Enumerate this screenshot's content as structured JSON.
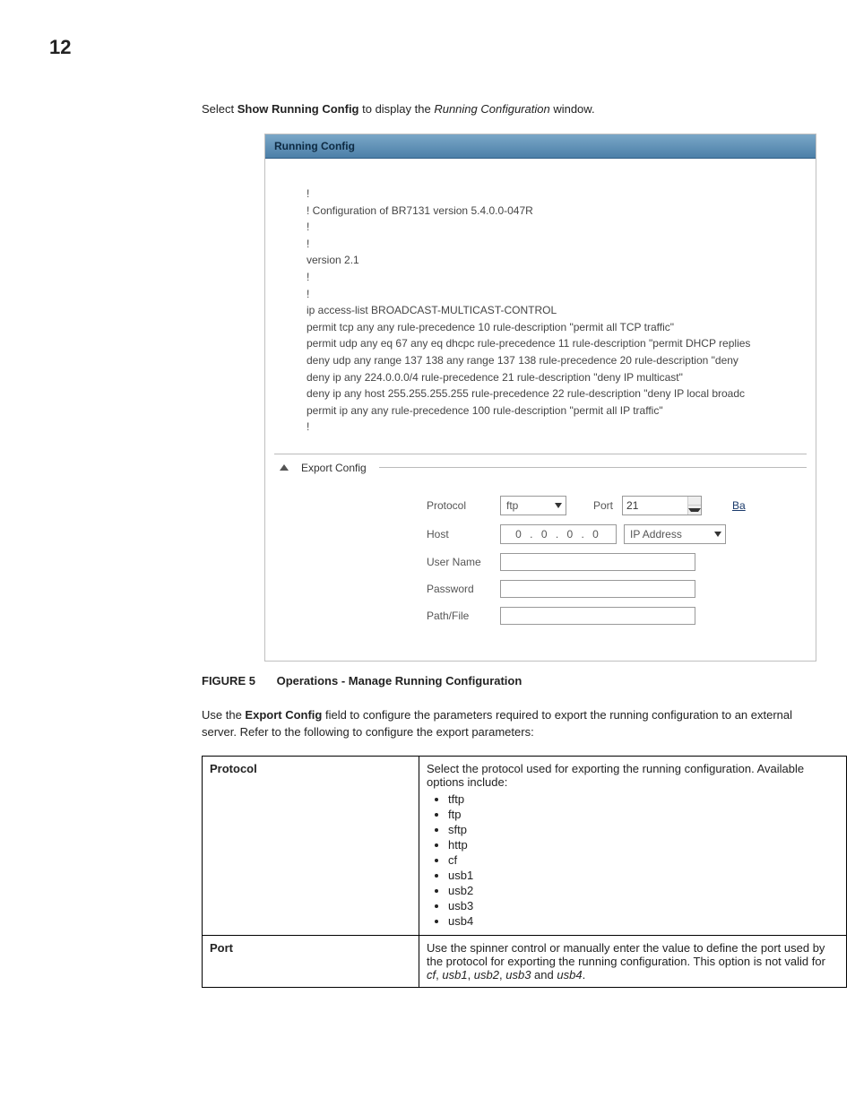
{
  "page_number": "12",
  "intro": {
    "prefix": "Select ",
    "bold": "Show Running Config",
    "mid": " to display the ",
    "italic": "Running Configuration",
    "suffix": " window."
  },
  "window": {
    "title": "Running Config",
    "config_lines": [
      "!",
      "! Configuration of BR7131 version 5.4.0.0-047R",
      "!",
      "!",
      "version 2.1",
      "!",
      "!",
      "ip access-list BROADCAST-MULTICAST-CONTROL",
      " permit tcp any any rule-precedence 10 rule-description \"permit all TCP traffic\"",
      " permit udp any eq 67 any eq dhcpc rule-precedence 11 rule-description \"permit DHCP replies",
      " deny udp any range 137 138 any range 137 138 rule-precedence 20 rule-description \"deny",
      " deny ip any 224.0.0.0/4 rule-precedence 21 rule-description \"deny IP multicast\"",
      " deny ip any host 255.255.255.255 rule-precedence 22 rule-description \"deny IP local broadc",
      " permit ip any any rule-precedence 100 rule-description \"permit all IP traffic\"",
      "!"
    ],
    "export_section_title": "Export Config",
    "form": {
      "protocol_label": "Protocol",
      "protocol_value": "ftp",
      "port_label": "Port",
      "port_value": "21",
      "trailing_link": "Ba",
      "host_label": "Host",
      "host_value": "0  .  0  .  0  .  0",
      "host_type": "IP Address",
      "username_label": "User Name",
      "password_label": "Password",
      "pathfile_label": "Path/File"
    }
  },
  "caption": {
    "figure": "FIGURE 5",
    "text": "Operations - Manage Running Configuration"
  },
  "body_para": {
    "a": "Use the ",
    "b": "Export Config",
    "c": " field to configure the parameters required to export the running configuration to an external server. Refer to the following to configure the export parameters:"
  },
  "table": {
    "rows": [
      {
        "key": "Protocol",
        "desc_intro": "Select the protocol used for exporting the running configuration. Available options include:",
        "items": [
          "tftp",
          "ftp",
          "sftp",
          "http",
          "cf",
          "usb1",
          "usb2",
          "usb3",
          "usb4"
        ]
      },
      {
        "key": "Port",
        "desc_parts": {
          "a": "Use the spinner control or manually enter the value to define the port used by the protocol for exporting the running configuration. This option is not valid for ",
          "i1": "cf",
          "b": ", ",
          "i2": "usb1",
          "c": ", ",
          "i3": "usb2",
          "d": ", ",
          "i4": "usb3",
          "e": " and ",
          "i5": "usb4",
          "f": "."
        }
      }
    ]
  }
}
